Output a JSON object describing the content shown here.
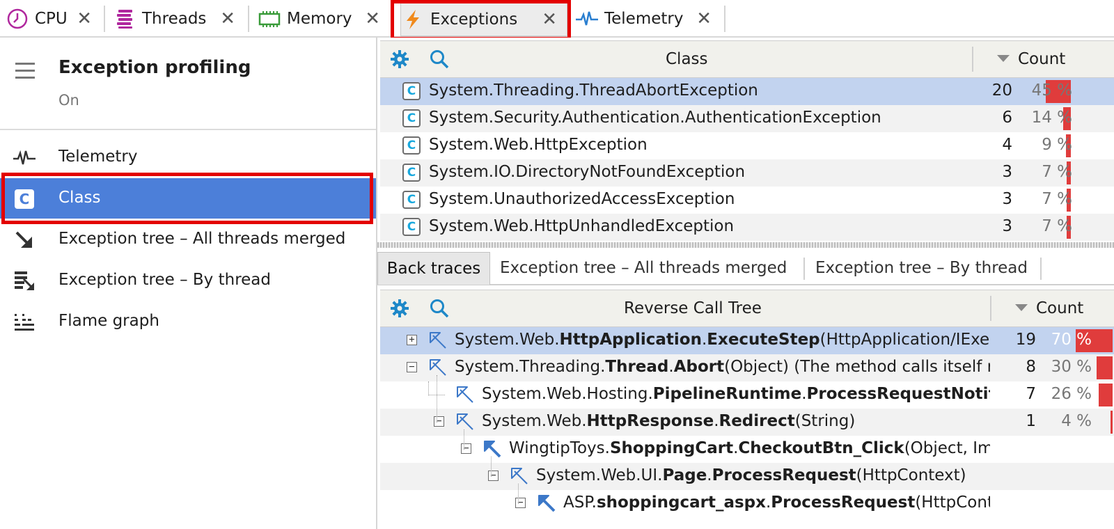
{
  "tabs": [
    {
      "label": "CPU",
      "icon": "clock-icon"
    },
    {
      "label": "Threads",
      "icon": "threads-icon"
    },
    {
      "label": "Memory",
      "icon": "memory-chip-icon"
    },
    {
      "label": "Exceptions",
      "icon": "lightning-icon",
      "active": true
    },
    {
      "label": "Telemetry",
      "icon": "pulse-icon"
    }
  ],
  "close_glyph": "✕",
  "left_panel": {
    "title": "Exception profiling",
    "status": "On",
    "items": [
      {
        "label": "Telemetry",
        "icon": "pulse-icon"
      },
      {
        "label": "Class",
        "icon": "class-icon",
        "icon_text": "C",
        "selected": true
      },
      {
        "label": "Exception tree – All threads merged",
        "icon": "arrow-down-right-icon"
      },
      {
        "label": "Exception tree – By thread",
        "icon": "threads-tree-icon"
      },
      {
        "label": "Flame graph",
        "icon": "flame-graph-icon"
      }
    ]
  },
  "class_table": {
    "col_class": "Class",
    "col_count": "Count",
    "class_icon_text": "C",
    "rows": [
      {
        "name": "System.Threading.ThreadAbortException",
        "count": "20",
        "percent": "45 %",
        "fraction": 0.45
      },
      {
        "name": "System.Security.Authentication.AuthenticationException",
        "count": "6",
        "percent": "14 %",
        "fraction": 0.14
      },
      {
        "name": "System.Web.HttpException",
        "count": "4",
        "percent": "9 %",
        "fraction": 0.09
      },
      {
        "name": "System.IO.DirectoryNotFoundException",
        "count": "3",
        "percent": "7 %",
        "fraction": 0.07
      },
      {
        "name": "System.UnauthorizedAccessException",
        "count": "3",
        "percent": "7 %",
        "fraction": 0.07
      },
      {
        "name": "System.Web.HttpUnhandledException",
        "count": "3",
        "percent": "7 %",
        "fraction": 0.07
      }
    ]
  },
  "sub_tabs": [
    "Back traces",
    "Exception tree – All threads merged",
    "Exception tree – By thread"
  ],
  "tree_table": {
    "col_title": "Reverse Call Tree",
    "col_count": "Count",
    "rows": [
      {
        "parts": [
          [
            "System.Web.",
            false
          ],
          [
            "HttpApplication",
            true
          ],
          [
            ".",
            false
          ],
          [
            "ExecuteStep",
            true
          ],
          [
            "(HttpApplication/IExecutionStep, ref Boolean)",
            false
          ]
        ],
        "count": "19",
        "percent": "70 %",
        "fraction": 0.7,
        "toggle": "+"
      },
      {
        "parts": [
          [
            "System.Threading.",
            false
          ],
          [
            "Thread",
            true
          ],
          [
            ".",
            false
          ],
          [
            "Abort",
            true
          ],
          [
            "(Object) (The method calls itself recursively)",
            false
          ]
        ],
        "count": "8",
        "percent": "30 %",
        "fraction": 0.3,
        "toggle": "−"
      },
      {
        "parts": [
          [
            "System.Web.Hosting.",
            false
          ],
          [
            "PipelineRuntime",
            true
          ],
          [
            ".",
            false
          ],
          [
            "ProcessRequestNotificationHelper",
            true
          ]
        ],
        "count": "7",
        "percent": "26 %",
        "fraction": 0.26,
        "toggle": ""
      },
      {
        "parts": [
          [
            "System.Web.",
            false
          ],
          [
            "HttpResponse",
            true
          ],
          [
            ".",
            false
          ],
          [
            "Redirect",
            true
          ],
          [
            "(String)",
            false
          ]
        ],
        "count": "1",
        "percent": "4 %",
        "fraction": 0.04,
        "toggle": "−"
      },
      {
        "parts": [
          [
            "WingtipToys.",
            false
          ],
          [
            "ShoppingCart",
            true
          ],
          [
            ".",
            false
          ],
          [
            "CheckoutBtn_Click",
            true
          ],
          [
            "(Object, ImageClickEventArgs)",
            false
          ]
        ],
        "count": "",
        "percent": "",
        "fraction": 0,
        "toggle": "−"
      },
      {
        "parts": [
          [
            "System.Web.UI.",
            false
          ],
          [
            "Page",
            true
          ],
          [
            ".",
            false
          ],
          [
            "ProcessRequest",
            true
          ],
          [
            "(HttpContext)",
            false
          ]
        ],
        "count": "",
        "percent": "",
        "fraction": 0,
        "toggle": "−"
      },
      {
        "parts": [
          [
            "ASP.",
            false
          ],
          [
            "shoppingcart_aspx",
            true
          ],
          [
            ".",
            false
          ],
          [
            "ProcessRequest",
            true
          ],
          [
            "(HttpContext)",
            false
          ]
        ],
        "count": "",
        "percent": "",
        "fraction": 0,
        "toggle": "−"
      }
    ]
  },
  "colors": {
    "accent_selection": "#4c7fd9",
    "row_selected": "#c2d3ef",
    "percent_bar": "#e03c3c",
    "highlight_box": "#e30000"
  }
}
